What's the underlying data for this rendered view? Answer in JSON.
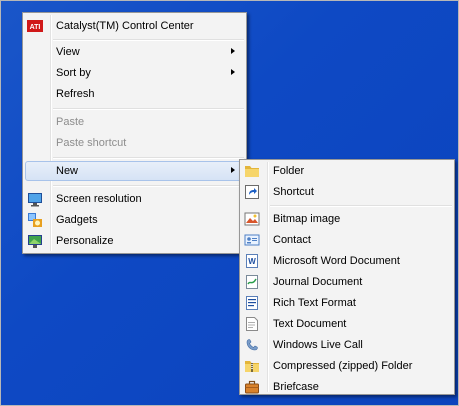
{
  "context_menu": {
    "catalyst": "Catalyst(TM) Control Center",
    "view": "View",
    "sort_by": "Sort by",
    "refresh": "Refresh",
    "paste": "Paste",
    "paste_shortcut": "Paste shortcut",
    "new": "New",
    "screen_resolution": "Screen resolution",
    "gadgets": "Gadgets",
    "personalize": "Personalize"
  },
  "new_submenu": {
    "folder": "Folder",
    "shortcut": "Shortcut",
    "bitmap": "Bitmap image",
    "contact": "Contact",
    "word": "Microsoft Word Document",
    "journal": "Journal Document",
    "rtf": "Rich Text Format",
    "text": "Text Document",
    "live_call": "Windows Live Call",
    "zip": "Compressed (zipped) Folder",
    "briefcase": "Briefcase"
  },
  "icons": {
    "catalyst": "ati-logo-icon",
    "screen_resolution": "monitor-icon",
    "gadgets": "gadgets-icon",
    "personalize": "personalize-icon",
    "folder": "folder-icon",
    "shortcut": "shortcut-icon",
    "bitmap": "paint-icon",
    "contact": "contact-card-icon",
    "word": "word-document-icon",
    "journal": "journal-icon",
    "rtf": "rich-text-icon",
    "text": "text-document-icon",
    "live_call": "phone-icon",
    "zip": "zip-folder-icon",
    "briefcase": "briefcase-icon"
  },
  "colors": {
    "desktop": "#0e49c4",
    "menu_bg": "#f3f3f3",
    "highlight_border": "#a8c3ea",
    "disabled_text": "#8d8d8d"
  }
}
